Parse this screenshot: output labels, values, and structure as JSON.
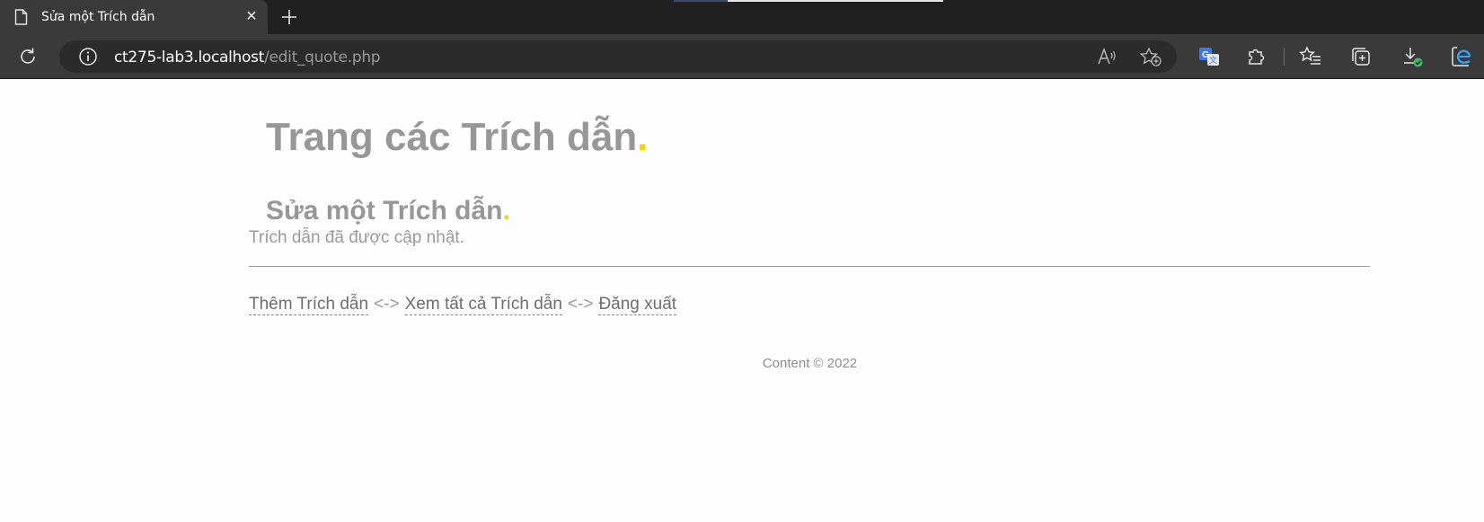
{
  "browser": {
    "tab": {
      "title": "Sửa một Trích dẫn"
    },
    "address": {
      "host": "ct275-lab3.localhost",
      "path": "/edit_quote.php"
    },
    "icons": {
      "page": "page-icon",
      "close": "close-icon",
      "new_tab": "plus-icon",
      "refresh": "refresh-icon",
      "info": "info-icon",
      "read_aloud": "read-aloud-icon",
      "add_favorite": "star-add-icon",
      "translate": "translate-icon",
      "extensions": "puzzle-icon",
      "favorites": "favorites-list-icon",
      "collections": "collections-icon",
      "downloads": "download-icon",
      "edge": "edge-icon"
    },
    "accent_colors": {
      "tab_bg": "#3a3a3a",
      "strip_bg": "#202020",
      "translate_blue": "#3b78e7",
      "download_green": "#3bbf6c"
    }
  },
  "page": {
    "site_title": "Trang các Trích dẫn",
    "site_title_dot": ".",
    "heading": "Sửa một Trích dẫn",
    "heading_dot": ".",
    "message": "Trích dẫn đã được cập nhật.",
    "nav": {
      "add_label": "Thêm Trích dẫn",
      "sep1": "<->",
      "view_all_label": "Xem tất cả Trích dẫn",
      "sep2": "<->",
      "logout_label": "Đăng xuất"
    },
    "footer": "Content © 2022",
    "colors": {
      "title_gray": "#979797",
      "dot_yellow": "#f5d300"
    }
  }
}
